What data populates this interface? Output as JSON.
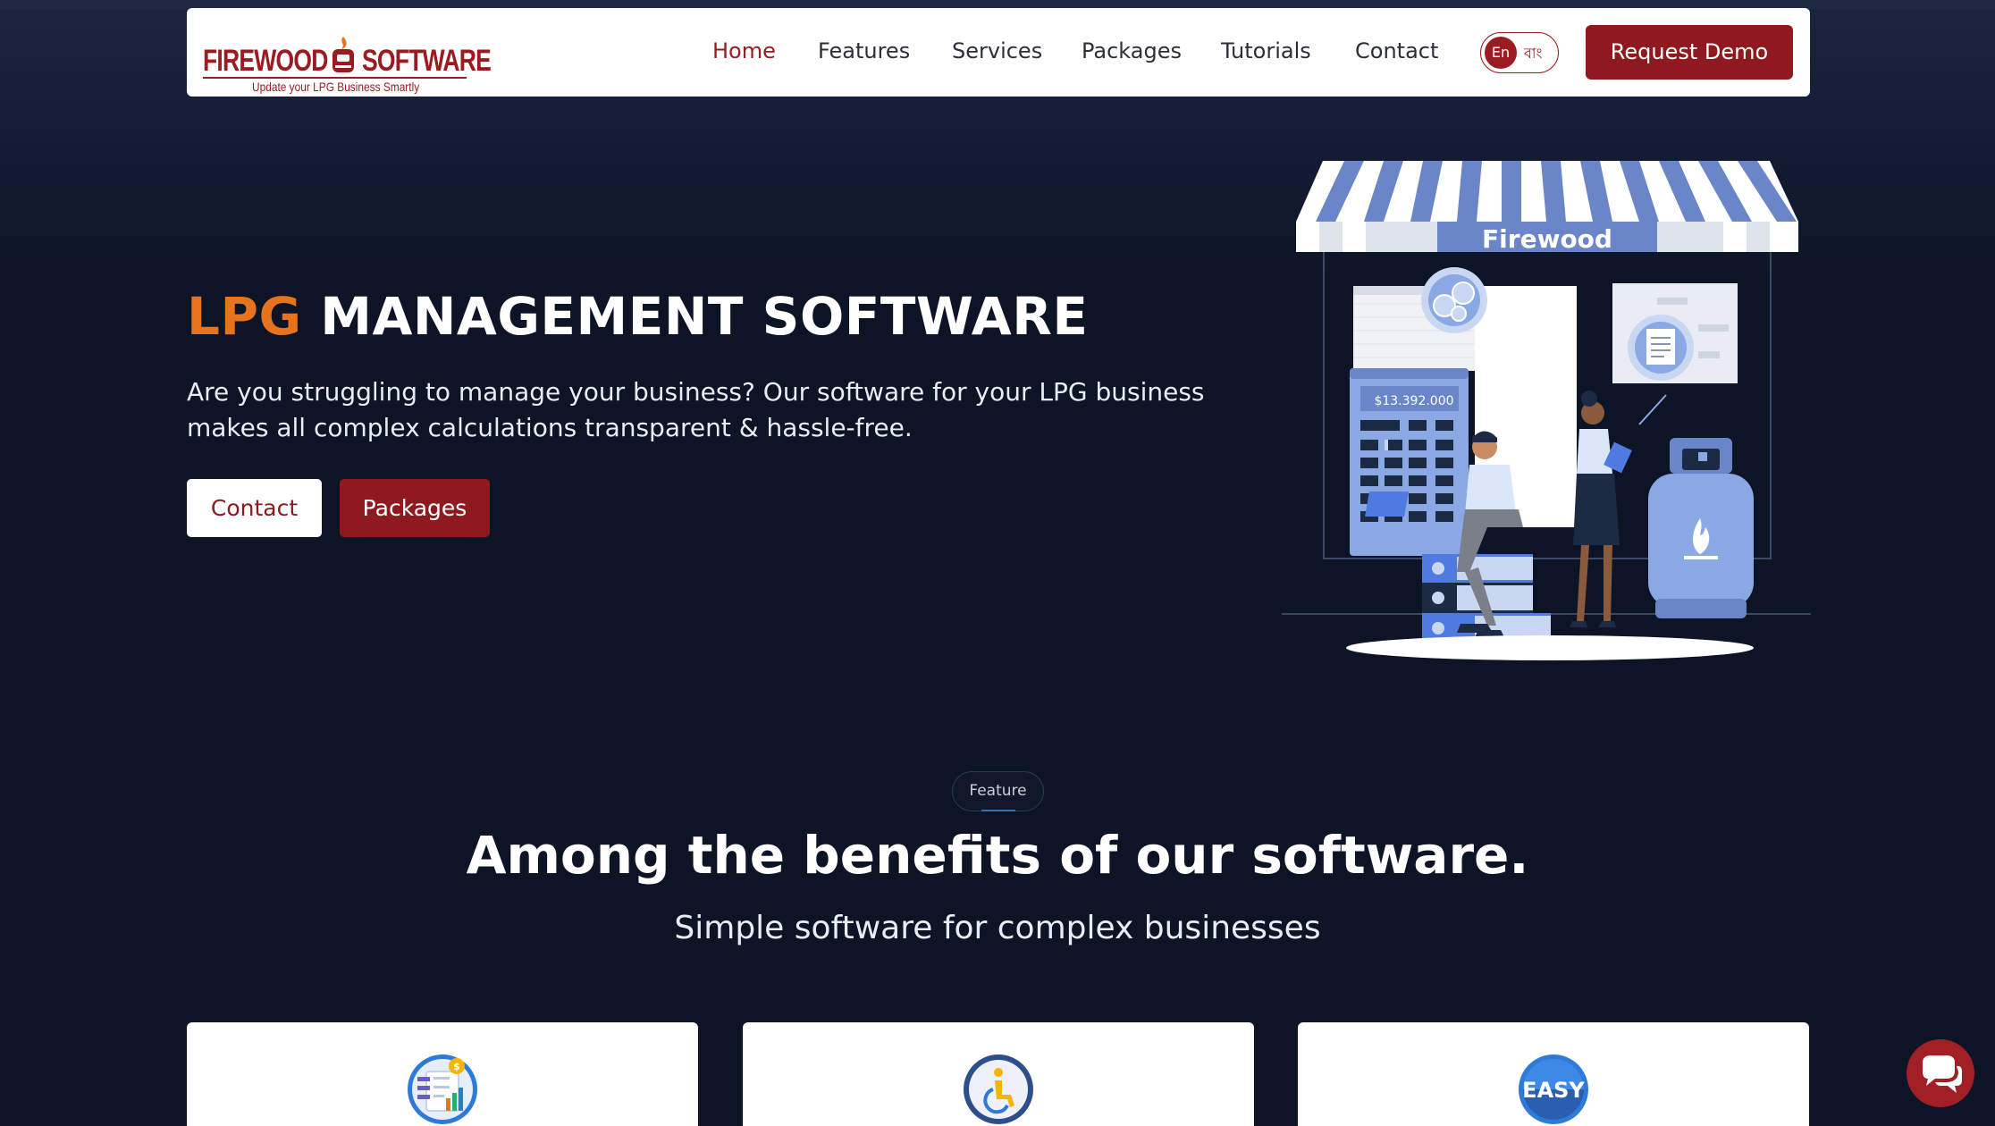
{
  "logo": {
    "left_word": "FIREWOOD",
    "right_word": "SOFTWARE",
    "tagline": "Update your LPG Business Smartly"
  },
  "nav": {
    "items": [
      {
        "label": "Home",
        "active": true
      },
      {
        "label": "Features"
      },
      {
        "label": "Services"
      },
      {
        "label": "Packages"
      },
      {
        "label": "Tutorials"
      },
      {
        "label": "Contact"
      }
    ],
    "lang_en": "En",
    "lang_bn": "বাং",
    "demo_label": "Request Demo"
  },
  "hero": {
    "title_accent": "LPG",
    "title_rest": "MANAGEMENT SOFTWARE",
    "description": "Are you struggling to manage your business? Our software for your LPG business makes all complex calculations transparent & hassle-free.",
    "contact_label": "Contact",
    "packages_label": "Packages",
    "illustration": {
      "awning_text": "Firewood",
      "calculator_display": "$13.392.000"
    }
  },
  "feature": {
    "badge": "Feature",
    "title": "Among the benefits of our software.",
    "subtitle": "Simple software for complex businesses",
    "cards": [
      {
        "icon": "report-chart-icon"
      },
      {
        "icon": "accessibility-icon"
      },
      {
        "icon": "easy-badge-icon",
        "icon_text": "EASY"
      }
    ]
  },
  "colors": {
    "brand_red": "#8e1a20",
    "accent_orange": "#e8731d",
    "background": "#0d1426"
  }
}
